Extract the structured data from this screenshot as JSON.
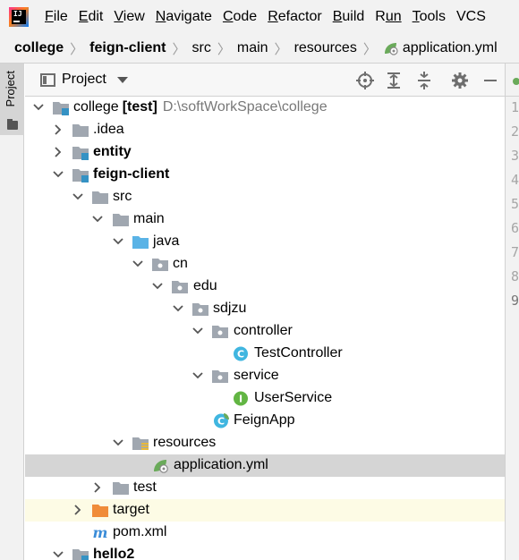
{
  "menu": {
    "items": [
      {
        "key": "F",
        "rest": "ile"
      },
      {
        "key": "E",
        "rest": "dit"
      },
      {
        "key": "V",
        "rest": "iew"
      },
      {
        "key": "N",
        "rest": "avigate"
      },
      {
        "key": "C",
        "rest": "ode"
      },
      {
        "key": "R",
        "rest": "efactor"
      },
      {
        "key": "B",
        "rest": "uild"
      },
      {
        "key": "R",
        "rest": "un",
        "first": "R",
        "under_index": 1
      },
      {
        "key": "T",
        "rest": "ools"
      },
      {
        "key": "VCS",
        "rest": ""
      }
    ]
  },
  "breadcrumb": {
    "items": [
      "college",
      "feign-client",
      "src",
      "main",
      "resources",
      "application.yml"
    ]
  },
  "side": {
    "project_tab": "Project"
  },
  "panel": {
    "title": "Project"
  },
  "tree": {
    "rows": [
      {
        "label": "college",
        "tag": "[test]",
        "hint": "D:\\softWorkSpace\\college",
        "bold": false
      },
      {
        "label": ".idea"
      },
      {
        "label": "entity"
      },
      {
        "label": "feign-client"
      },
      {
        "label": "src"
      },
      {
        "label": "main"
      },
      {
        "label": "java"
      },
      {
        "label": "cn"
      },
      {
        "label": "edu"
      },
      {
        "label": "sdjzu"
      },
      {
        "label": "controller"
      },
      {
        "label": "TestController"
      },
      {
        "label": "service"
      },
      {
        "label": "UserService"
      },
      {
        "label": "FeignApp"
      },
      {
        "label": "resources"
      },
      {
        "label": "application.yml"
      },
      {
        "label": "test"
      },
      {
        "label": "target"
      },
      {
        "label": "pom.xml"
      },
      {
        "label": "hello2"
      }
    ]
  },
  "gutter": [
    "1",
    "2",
    "3",
    "4",
    "5",
    "6",
    "7",
    "8",
    "9"
  ],
  "colors": {
    "folder": "#a0a7b0",
    "module_badge": "#3592c4",
    "java_folder": "#5ab3e6",
    "class_icon": "#40b6e0",
    "interface_icon": "#62b543",
    "spring": "#6aaa5a",
    "target_folder": "#f08c3a",
    "maven": "#3a8cd8",
    "selection": "#d5d5d5",
    "excluded_bg": "#fdfbe5"
  }
}
